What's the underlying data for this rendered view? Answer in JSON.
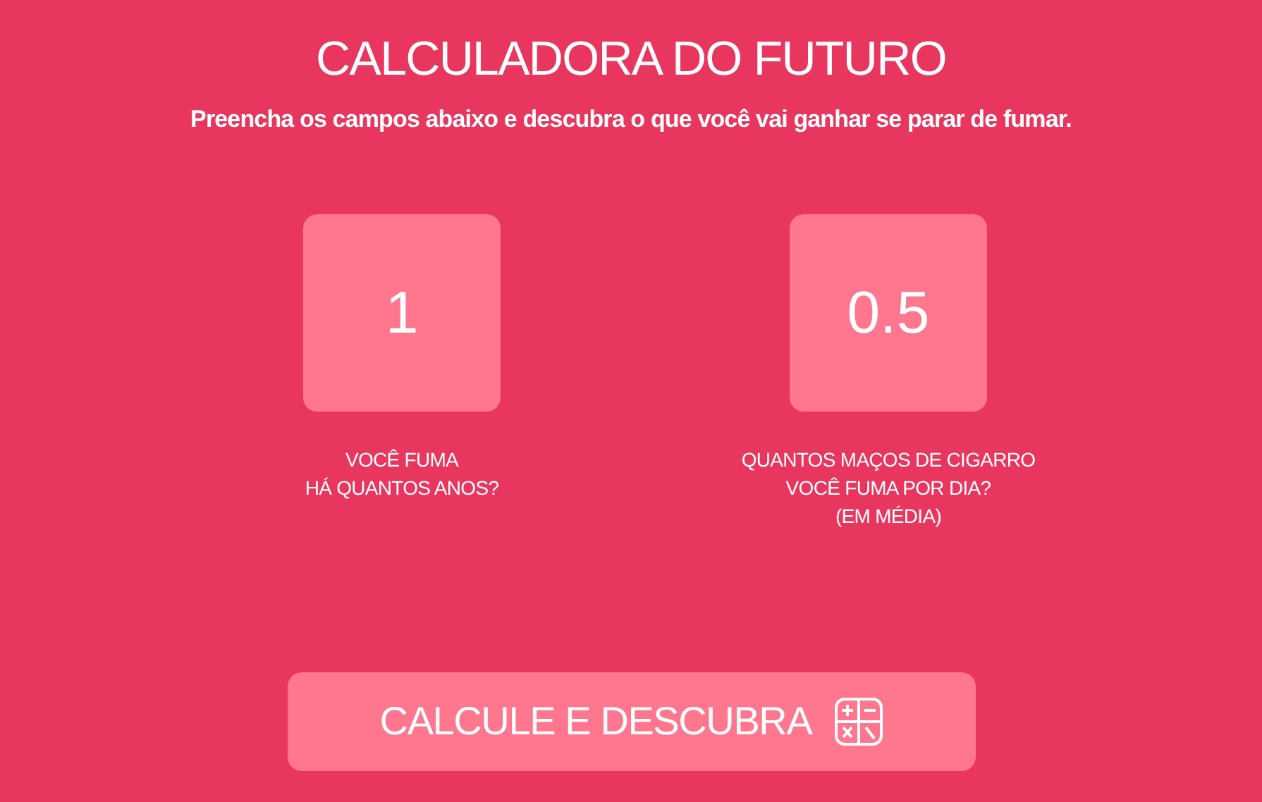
{
  "title": "CALCULADORA DO FUTURO",
  "subtitle": "Preencha os campos abaixo e descubra o que você vai ganhar se parar de fumar.",
  "fields": [
    {
      "value": "1",
      "label_lines": [
        "VOCÊ FUMA",
        "HÁ QUANTOS ANOS?"
      ]
    },
    {
      "value": "0.5",
      "label_lines": [
        "QUANTOS MAÇOS DE CIGARRO",
        "VOCÊ FUMA POR DIA?",
        "(EM MÉDIA)"
      ]
    }
  ],
  "button": {
    "label": "CALCULE E DESCUBRA"
  }
}
